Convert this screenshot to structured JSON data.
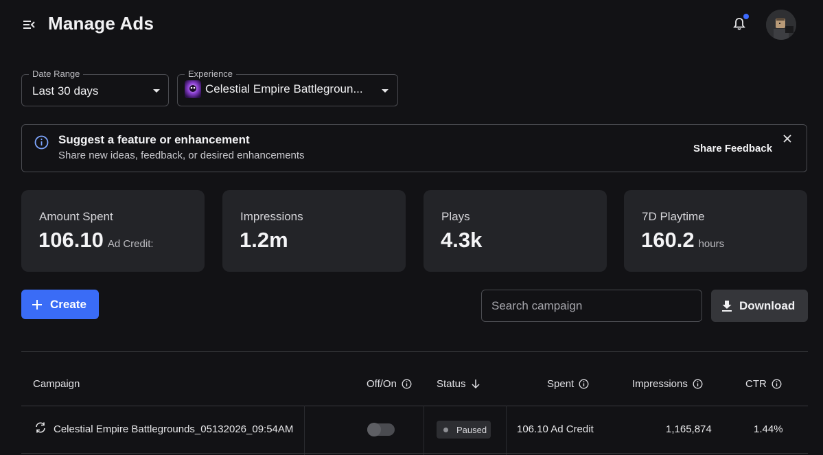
{
  "header": {
    "title": "Manage Ads"
  },
  "filters": {
    "date_range": {
      "label": "Date Range",
      "value": "Last 30 days"
    },
    "experience": {
      "label": "Experience",
      "value": "Celestial Empire Battlegroun..."
    }
  },
  "banner": {
    "title": "Suggest a feature or enhancement",
    "subtitle": "Share new ideas, feedback, or desired enhancements",
    "action": "Share Feedback"
  },
  "stats": [
    {
      "label": "Amount Spent",
      "value": "106.10",
      "unit": "Ad Credit:"
    },
    {
      "label": "Impressions",
      "value": "1.2m",
      "unit": ""
    },
    {
      "label": "Plays",
      "value": "4.3k",
      "unit": ""
    },
    {
      "label": "7D Playtime",
      "value": "160.2",
      "unit": "hours"
    }
  ],
  "actions": {
    "create_label": "Create",
    "search_placeholder": "Search campaign",
    "download_label": "Download"
  },
  "table": {
    "columns": [
      "Campaign",
      "Off/On",
      "Status",
      "Spent",
      "Impressions",
      "CTR"
    ],
    "rows": [
      {
        "campaign": "Celestial Empire Battlegrounds_05132026_09:54AM",
        "enabled": false,
        "status": "Paused",
        "spent": "106.10 Ad Credit",
        "impressions": "1,165,874",
        "ctr": "1.44%"
      }
    ]
  },
  "colors": {
    "background": "#121215",
    "card": "#232428",
    "accent": "#3a6cf6",
    "notification_dot": "#3d6bff"
  },
  "icons": {
    "menu": "menu-collapse-icon",
    "bell": "bell-icon",
    "info": "info-icon",
    "close": "close-icon",
    "plus": "plus-icon",
    "download": "download-icon",
    "sort": "arrow-down-icon",
    "sync": "sync-icon"
  }
}
